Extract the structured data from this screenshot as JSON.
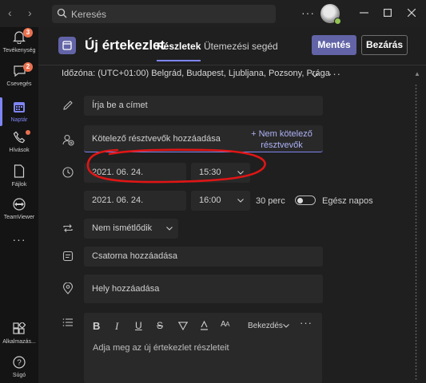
{
  "titlebar": {
    "search_placeholder": "Keresés",
    "more": "···"
  },
  "rail": {
    "items": [
      {
        "label": "Tevékenység",
        "badge": "3"
      },
      {
        "label": "Csevegés",
        "badge": "2"
      },
      {
        "label": "Naptár"
      },
      {
        "label": "Hívások"
      },
      {
        "label": "Fájlok"
      },
      {
        "label": "TeamViewer"
      },
      {
        "label": "Alkalmazás..."
      },
      {
        "label": "Súgó"
      }
    ],
    "more": "···"
  },
  "header": {
    "title": "Új értekezlet",
    "tabs": [
      {
        "label": "Részletek",
        "active": true
      },
      {
        "label": "Ütemezési segéd",
        "active": false
      }
    ],
    "save_label": "Mentés",
    "close_label": "Bezárás"
  },
  "timezone": {
    "text": "Időzóna: (UTC+01:00) Belgrád, Budapest, Ljubljana, Pozsony, Prága",
    "more": "···"
  },
  "form": {
    "title_placeholder": "Írja be a címet",
    "required_attendees_placeholder": "Kötelező résztvevők hozzáadása",
    "optional_attendees_label_line1": "+ Nem kötelező",
    "optional_attendees_label_line2": "résztvevők",
    "start_date": "2021. 06. 24.",
    "start_time": "15:30",
    "end_date": "2021. 06. 24.",
    "end_time": "16:00",
    "duration": "30 perc",
    "all_day_label": "Egész napos",
    "all_day_on": false,
    "repeat": "Nem ismétlődik",
    "channel_placeholder": "Csatorna hozzáadása",
    "location_placeholder": "Hely hozzáadása",
    "paragraph_style": "Bekezdés",
    "details_placeholder": "Adja meg az új értekezlet részleteit"
  },
  "colors": {
    "accent": "#6264a7",
    "accent_light": "#7f85f5",
    "badge": "#e9704f",
    "annotation": "#e01515",
    "presence": "#92c353"
  }
}
